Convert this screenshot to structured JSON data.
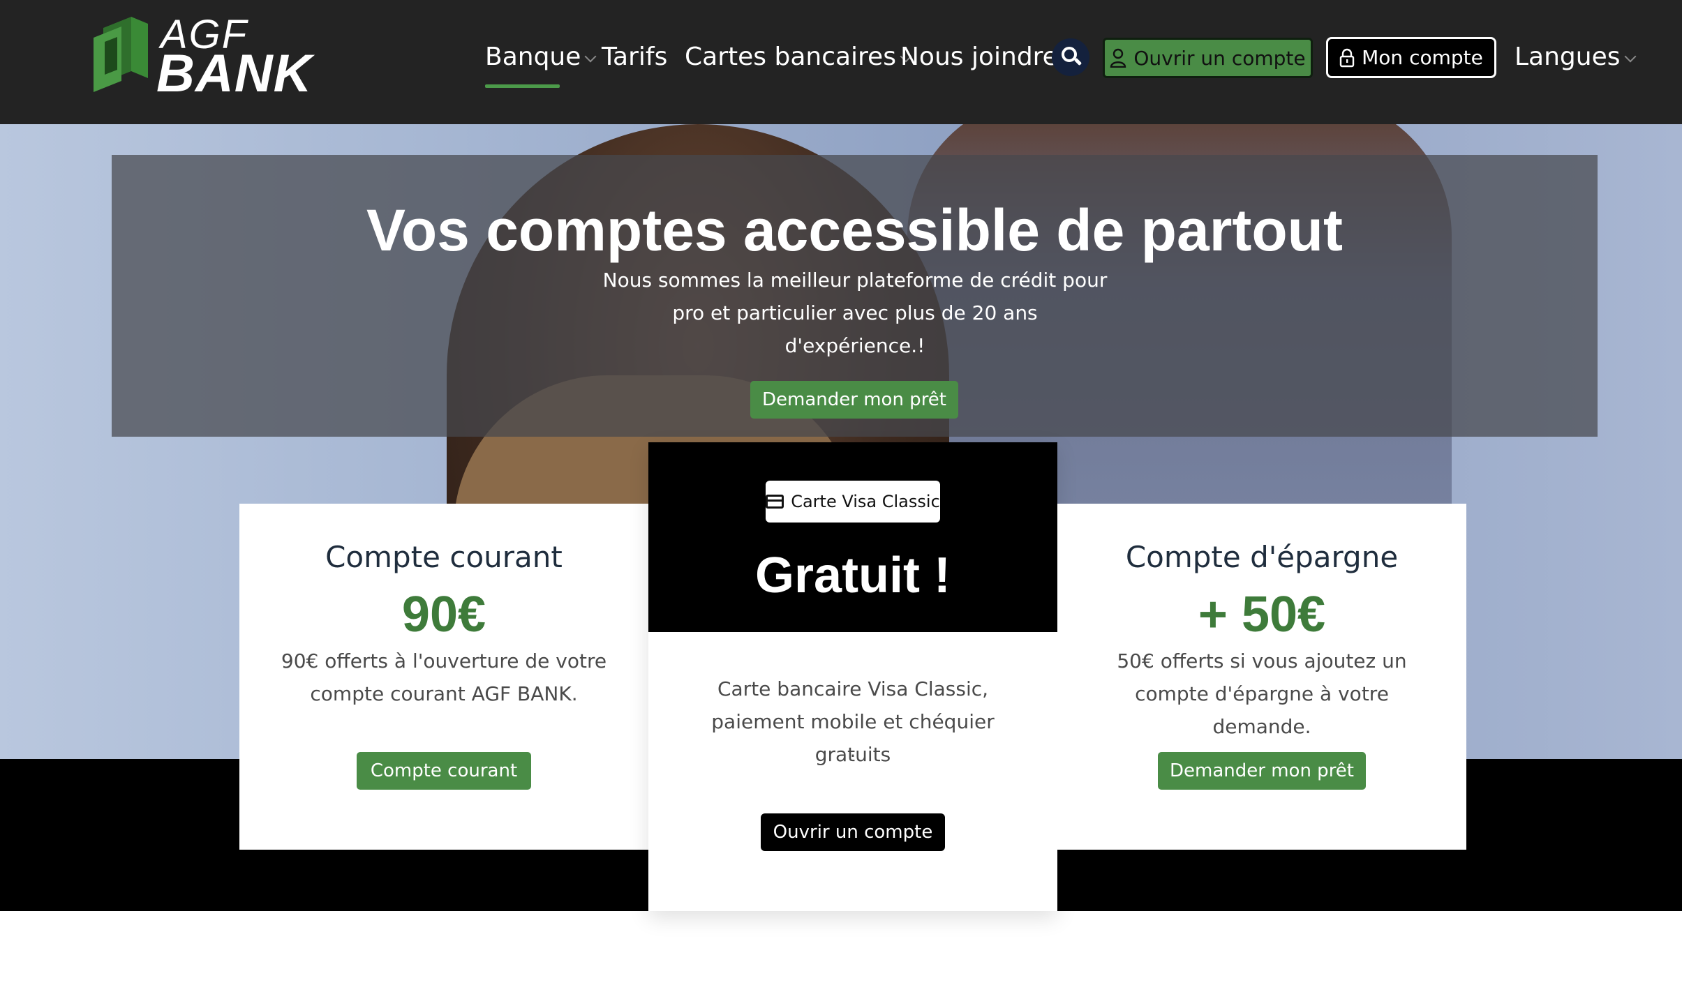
{
  "brand": {
    "top": "AGF",
    "bottom": "BANK"
  },
  "nav": {
    "items": [
      {
        "label": "Banque",
        "has_dropdown": true,
        "active": true
      },
      {
        "label": "Tarifs",
        "has_dropdown": false
      },
      {
        "label": "Cartes bancaires",
        "has_dropdown": true
      },
      {
        "label": "Nous joindre",
        "has_dropdown": false
      }
    ],
    "search_icon": "search-icon",
    "open_account_label": "Ouvrir un compte",
    "my_account_label": "Mon compte",
    "languages_label": "Langues"
  },
  "hero": {
    "title": "Vos comptes accessible de partout",
    "subtitle": "Nous sommes la meilleur plateforme de crédit pour pro et particulier avec plus de 20 ans d'expérience.!",
    "cta_label": "Demander mon prêt"
  },
  "cards": {
    "left": {
      "title": "Compte courant",
      "price": "90€",
      "desc": "90€ offerts à l'ouverture de votre compte courant AGF BANK.",
      "cta_label": "Compte courant"
    },
    "middle": {
      "badge": "Carte Visa Classic",
      "price": "Gratuit !",
      "desc_line1": "Carte bancaire Visa Classic,",
      "desc_line2": "paiement mobile et chéquier gratuits",
      "desc_line3": ".",
      "cta_label": "Ouvrir un compte"
    },
    "right": {
      "title": "Compte d'épargne",
      "price": "+ 50€",
      "desc": "50€ offerts si vous ajoutez un compte d'épargne à votre demande.",
      "cta_label": "Demander mon prêt"
    }
  },
  "colors": {
    "accent_green": "#4a8c46",
    "price_green": "#3e7b3a",
    "header_bg": "#232323",
    "search_bg": "#14213d"
  }
}
